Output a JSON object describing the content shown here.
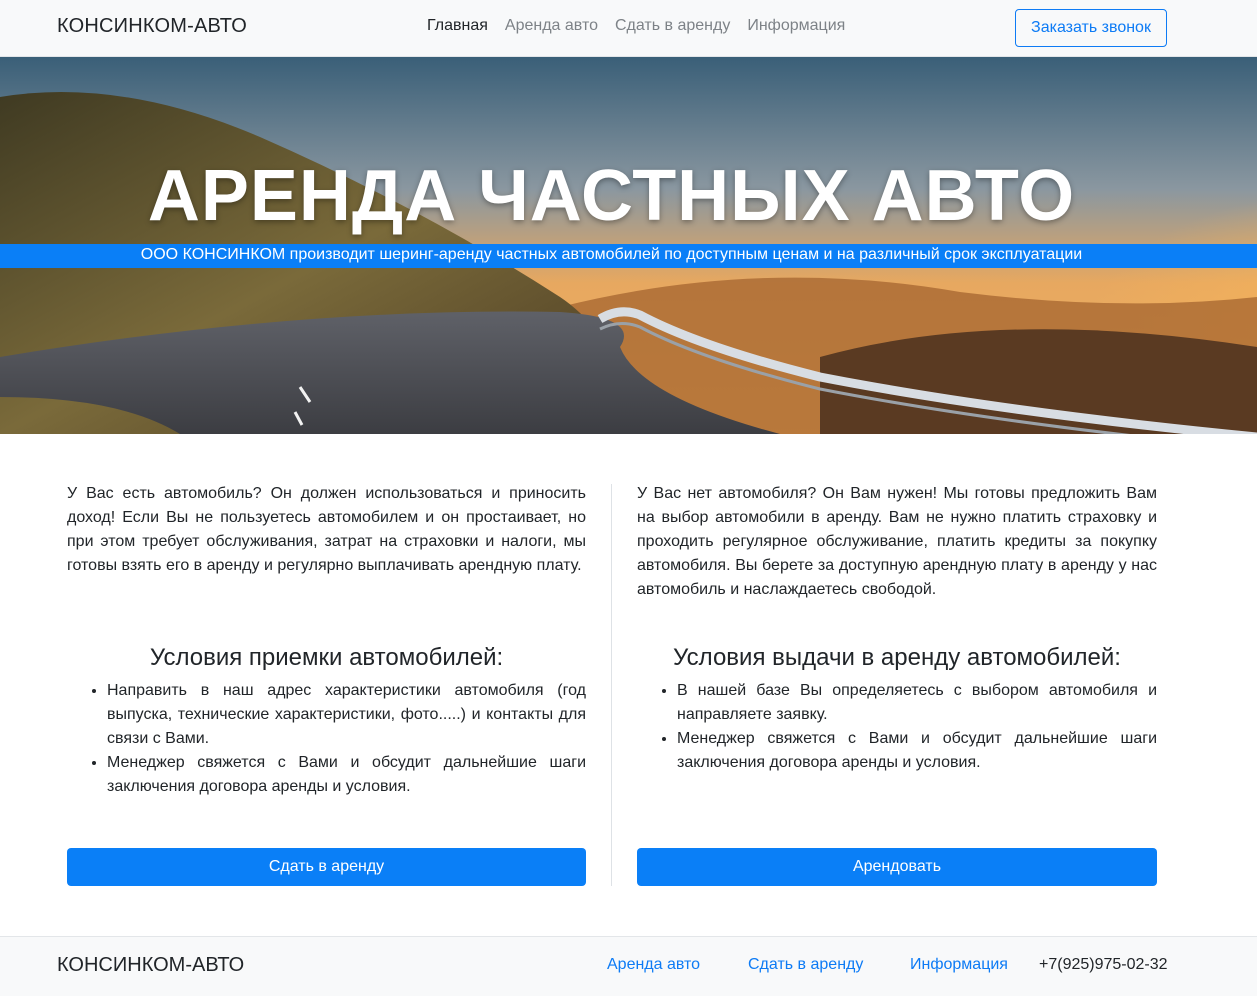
{
  "header": {
    "brand": "КОНСИНКОМ-АВТО",
    "nav": [
      "Главная",
      "Аренда авто",
      "Сдать в аренду",
      "Информация"
    ],
    "call_button": "Заказать звонок"
  },
  "hero": {
    "title": "АРЕНДА ЧАСТНЫХ АВТО",
    "subtitle": "ООО КОНСИНКОМ производит шеринг-аренду частных автомобилей по доступным ценам и на различный срок эксплуатации"
  },
  "left": {
    "paragraph": "У Вас есть автомобиль? Он должен использоваться и приносить доход! Если Вы не пользуетесь автомобилем и он простаивает, но при этом требует обслуживания, затрат на страховки и налоги, мы готовы взять его в аренду и регулярно выплачивать арендную плату.",
    "heading": "Условия приемки автомобилей:",
    "items": [
      "Направить в наш адрес характеристики автомобиля (год выпуска, технические характеристики, фото.....) и контакты для связи с Вами.",
      "Менеджер свяжется с Вами и обсудит дальнейшие шаги заключения договора аренды и условия."
    ],
    "button": "Сдать в аренду"
  },
  "right": {
    "paragraph": "У Вас нет автомобиля? Он Вам нужен! Мы готовы предложить Вам на выбор автомобили в аренду. Вам не нужно платить страховку и проходить регулярное обслуживание, платить кредиты за покупку автомобиля. Вы берете за доступную арендную плату в аренду у нас автомобиль и наслаждаетесь свободой.",
    "heading": "Условия выдачи в аренду автомобилей:",
    "items": [
      "В нашей базе Вы определяетесь с выбором автомобиля и направляете заявку.",
      "Менеджер свяжется с Вами и обсудит дальнейшие шаги заключения договора аренды и условия."
    ],
    "button": "Арендовать"
  },
  "footer": {
    "brand": "КОНСИНКОМ-АВТО",
    "links": [
      "Аренда авто",
      "Сдать в аренду",
      "Информация"
    ],
    "phone": "+7(925)975-02-32"
  },
  "colors": {
    "primary": "#0a7ff7",
    "link": "#0d7bf5",
    "navbar_bg": "#f8f9fa"
  }
}
